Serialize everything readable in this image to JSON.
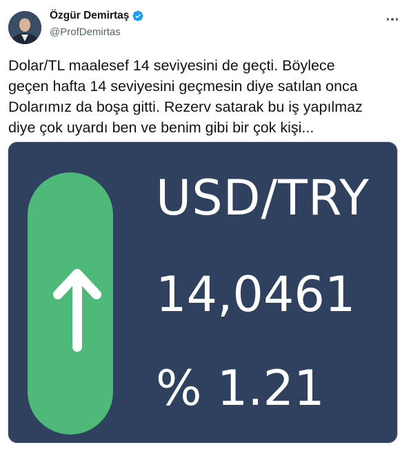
{
  "author": {
    "name": "Özgür Demirtaş",
    "handle": "@ProfDemirtas",
    "verified": true,
    "avatar_icon": "profile-photo",
    "verified_icon": "verified-badge-icon",
    "more_icon": "more-options-icon"
  },
  "tweet": {
    "lines": [
      "Dolar/TL maalesef 14 seviyesini de geçti. Böylece",
      "geçen hafta 14 seviyesini geçmesin diye satılan onca",
      "Dolarımız da boşa gitti. Rezerv satarak bu iş yapılmaz",
      "diye çok uyardı ben ve benim gibi bir çok kişi..."
    ]
  },
  "media": {
    "pair": "USD/TRY",
    "rate": "14,0461",
    "change": "% 1.21",
    "direction_icon": "arrow-up-icon",
    "background_color": "#30405f",
    "indicator_color": "#4fb97a"
  }
}
